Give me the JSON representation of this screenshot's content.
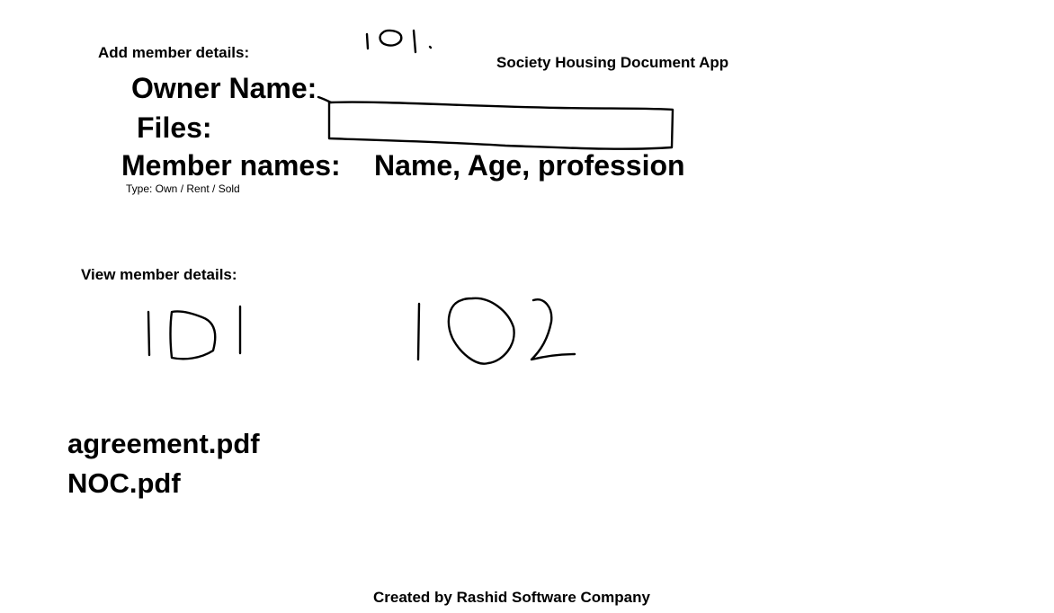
{
  "app": {
    "title": "Society Housing Document App"
  },
  "add_member": {
    "section_title": "Add member details:",
    "flat_number": "101",
    "owner_name_label": "Owner Name:",
    "owner_name_value": "",
    "files_label": "Files:",
    "member_names_label": "Member names:",
    "member_fields_hint": "Name, Age, profession",
    "type_hint": "Type: Own / Rent / Sold"
  },
  "view_member": {
    "section_title": "View member details:",
    "flats": [
      "101",
      "102"
    ]
  },
  "files": [
    "agreement.pdf",
    "NOC.pdf"
  ],
  "footer": {
    "credit": "Created by Rashid Software Company"
  }
}
